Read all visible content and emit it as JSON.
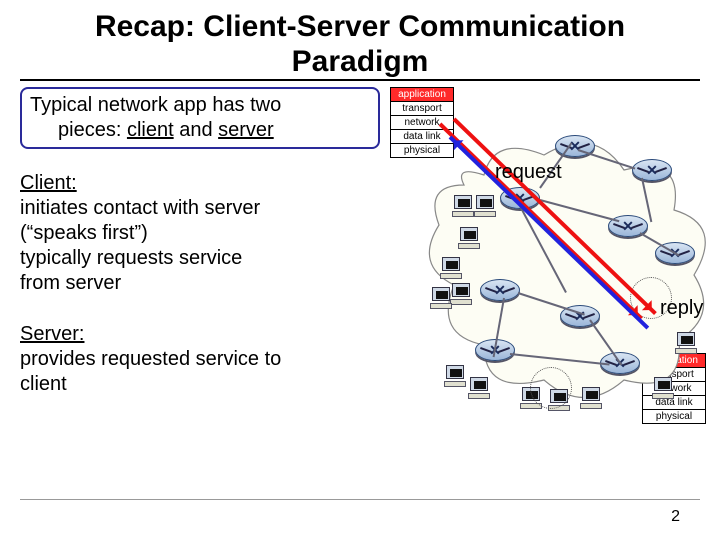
{
  "title": "Recap: Client-Server Communication Paradigm",
  "intro": {
    "line1": "Typical network app has two",
    "line2_pre": "pieces: ",
    "client_word": "client",
    "and_word": " and ",
    "server_word": "server"
  },
  "client": {
    "header": "Client:",
    "l1": "initiates contact with server",
    "l2": "(“speaks first”)",
    "l3": "typically requests service",
    "l4": "from server"
  },
  "server": {
    "header": "Server:",
    "l1": "provides requested service to",
    "l2": "client"
  },
  "stack": {
    "app": "application",
    "trans": "transport",
    "net": "network",
    "dl": "data link",
    "phy": "physical"
  },
  "annotations": {
    "request": "request",
    "reply": "reply"
  },
  "page_number": "2"
}
